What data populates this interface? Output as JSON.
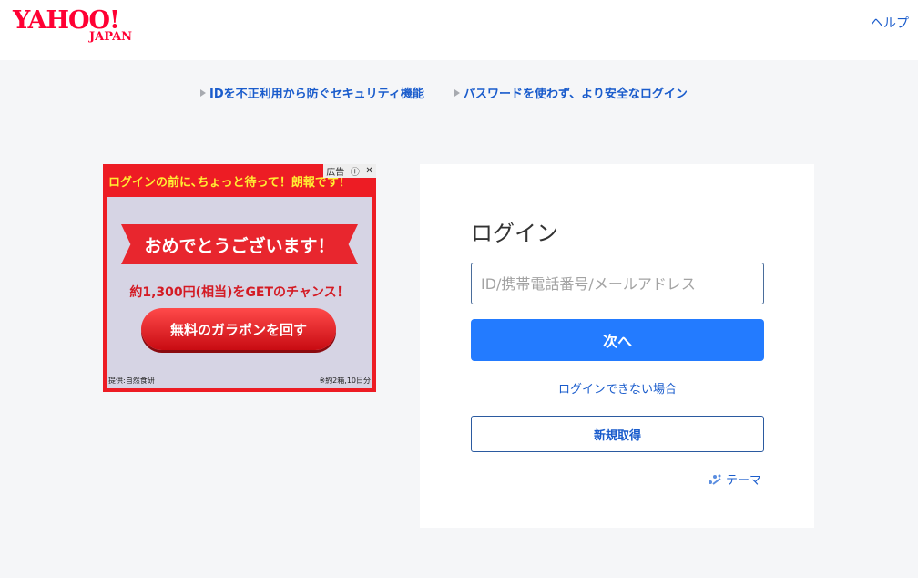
{
  "header": {
    "logo_main": "YAHOO!",
    "logo_sub": "JAPAN",
    "help_label": "ヘルプ"
  },
  "links": [
    {
      "label": "IDを不正利用から防ぐセキュリティ機能"
    },
    {
      "label": "パスワードを使わず、より安全なログイン"
    }
  ],
  "ad": {
    "badge_label": "広告",
    "top_text": "ログインの前に､ちょっと待って！朗報です！",
    "banner_text": "おめでとうございます！",
    "line_text": "約1,300円(相当)をGETのチャンス！",
    "button_label": "無料のガラポンを回す",
    "provider": "提供:自然食研",
    "note": "※約2箱,10日分"
  },
  "login": {
    "title": "ログイン",
    "input_placeholder": "ID/携帯電話番号/メールアドレス",
    "input_value": "",
    "next_label": "次へ",
    "cant_login_label": "ログインできない場合",
    "signup_label": "新規取得",
    "theme_label": "テーマ"
  },
  "colors": {
    "brand_red": "#ff0033",
    "link_blue": "#1a5ccc",
    "primary_button": "#237bff",
    "background": "#f5f6f8"
  }
}
